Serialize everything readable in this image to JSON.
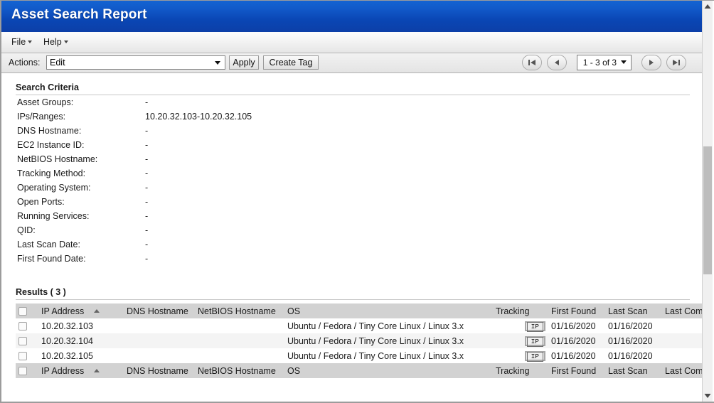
{
  "window": {
    "title": "Asset Search Report"
  },
  "menubar": {
    "items": [
      {
        "label": "File"
      },
      {
        "label": "Help"
      }
    ]
  },
  "toolbar": {
    "actions_label": "Actions:",
    "action_selected": "Edit",
    "apply_label": "Apply",
    "create_tag_label": "Create Tag"
  },
  "pager": {
    "first_icon": "first-page-icon",
    "prev_icon": "previous-page-icon",
    "range_label": "1 - 3 of 3",
    "next_icon": "next-page-icon",
    "last_icon": "last-page-icon"
  },
  "search_criteria": {
    "heading": "Search Criteria",
    "rows": [
      {
        "label": "Asset Groups:",
        "value": "-"
      },
      {
        "label": "IPs/Ranges:",
        "value": "10.20.32.103-10.20.32.105"
      },
      {
        "label": "DNS Hostname:",
        "value": "-"
      },
      {
        "label": "EC2 Instance ID:",
        "value": "-"
      },
      {
        "label": "NetBIOS Hostname:",
        "value": "-"
      },
      {
        "label": "Tracking Method:",
        "value": "-"
      },
      {
        "label": "Operating System:",
        "value": "-"
      },
      {
        "label": "Open Ports:",
        "value": "-"
      },
      {
        "label": "Running Services:",
        "value": "-"
      },
      {
        "label": "QID:",
        "value": "-"
      },
      {
        "label": "Last Scan Date:",
        "value": "-"
      },
      {
        "label": "First Found Date:",
        "value": "-"
      }
    ]
  },
  "results": {
    "heading": "Results ( 3 )",
    "columns": [
      {
        "key": "ip",
        "label": "IP Address",
        "sorted": "asc"
      },
      {
        "key": "dns",
        "label": "DNS Hostname"
      },
      {
        "key": "nb",
        "label": "NetBIOS Hostname"
      },
      {
        "key": "os",
        "label": "OS"
      },
      {
        "key": "tr",
        "label": "Tracking"
      },
      {
        "key": "ff",
        "label": "First Found"
      },
      {
        "key": "ls",
        "label": "Last Scan"
      },
      {
        "key": "lcs",
        "label": "Last Compliance Scan"
      }
    ],
    "rows": [
      {
        "ip": "10.20.32.103",
        "dns": "",
        "nb": "",
        "os": "Ubuntu / Fedora / Tiny Core Linux / Linux 3.x",
        "tracking": "IP",
        "first_found": "01/16/2020",
        "last_scan": "01/16/2020",
        "last_compliance_scan": ""
      },
      {
        "ip": "10.20.32.104",
        "dns": "",
        "nb": "",
        "os": "Ubuntu / Fedora / Tiny Core Linux / Linux 3.x",
        "tracking": "IP",
        "first_found": "01/16/2020",
        "last_scan": "01/16/2020",
        "last_compliance_scan": ""
      },
      {
        "ip": "10.20.32.105",
        "dns": "",
        "nb": "",
        "os": "Ubuntu / Fedora / Tiny Core Linux / Linux 3.x",
        "tracking": "IP",
        "first_found": "01/16/2020",
        "last_scan": "01/16/2020",
        "last_compliance_scan": ""
      }
    ]
  },
  "colors": {
    "titlebar_blue": "#0c4cc0",
    "header_gray": "#d2d2d2",
    "row_alt": "#f4f4f4",
    "frame_border": "#9c9c9c"
  }
}
